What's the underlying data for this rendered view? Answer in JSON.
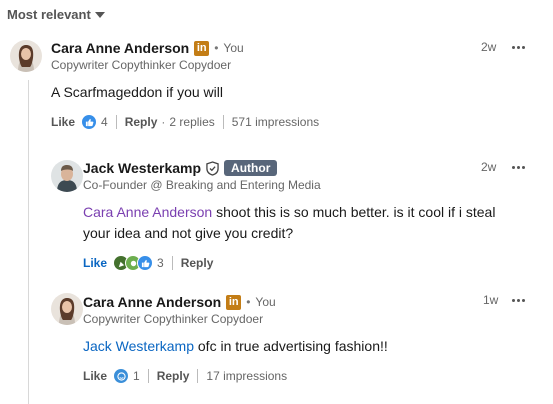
{
  "sort": {
    "label": "Most relevant"
  },
  "comments": [
    {
      "name": "Cara Anne Anderson",
      "linkedin_badge": "in",
      "you_label": "You",
      "headline": "Copywriter Copythinker Copydoer",
      "time": "2w",
      "text": "A Scarfmageddon if you will",
      "like_label": "Like",
      "reaction_count": "4",
      "reply_label": "Reply",
      "replies_label": "2 replies",
      "impressions": "571 impressions"
    },
    {
      "name": "Jack Westerkamp",
      "author_label": "Author",
      "headline": "Co-Founder @ Breaking and Entering Media",
      "time": "2w",
      "mention": "Cara Anne Anderson",
      "text_line1": " shoot this is so much better. is it cool if i steal",
      "text_line2": "your idea and not give you credit?",
      "like_label": "Like",
      "reaction_count": "3",
      "reply_label": "Reply"
    },
    {
      "name": "Cara Anne Anderson",
      "linkedin_badge": "in",
      "you_label": "You",
      "headline": "Copywriter Copythinker Copydoer",
      "time": "1w",
      "mention": "Jack Westerkamp",
      "text": " ofc in true advertising fashion!!",
      "like_label": "Like",
      "reaction_count": "1",
      "reply_label": "Reply",
      "impressions": "17 impressions"
    }
  ],
  "colors": {
    "linkedin_badge": "#c37d16",
    "author_badge": "#58667a",
    "mention_purple": "#7a3fb0",
    "mention_blue": "#0a66c2",
    "like_blue": "#0a66c2"
  }
}
